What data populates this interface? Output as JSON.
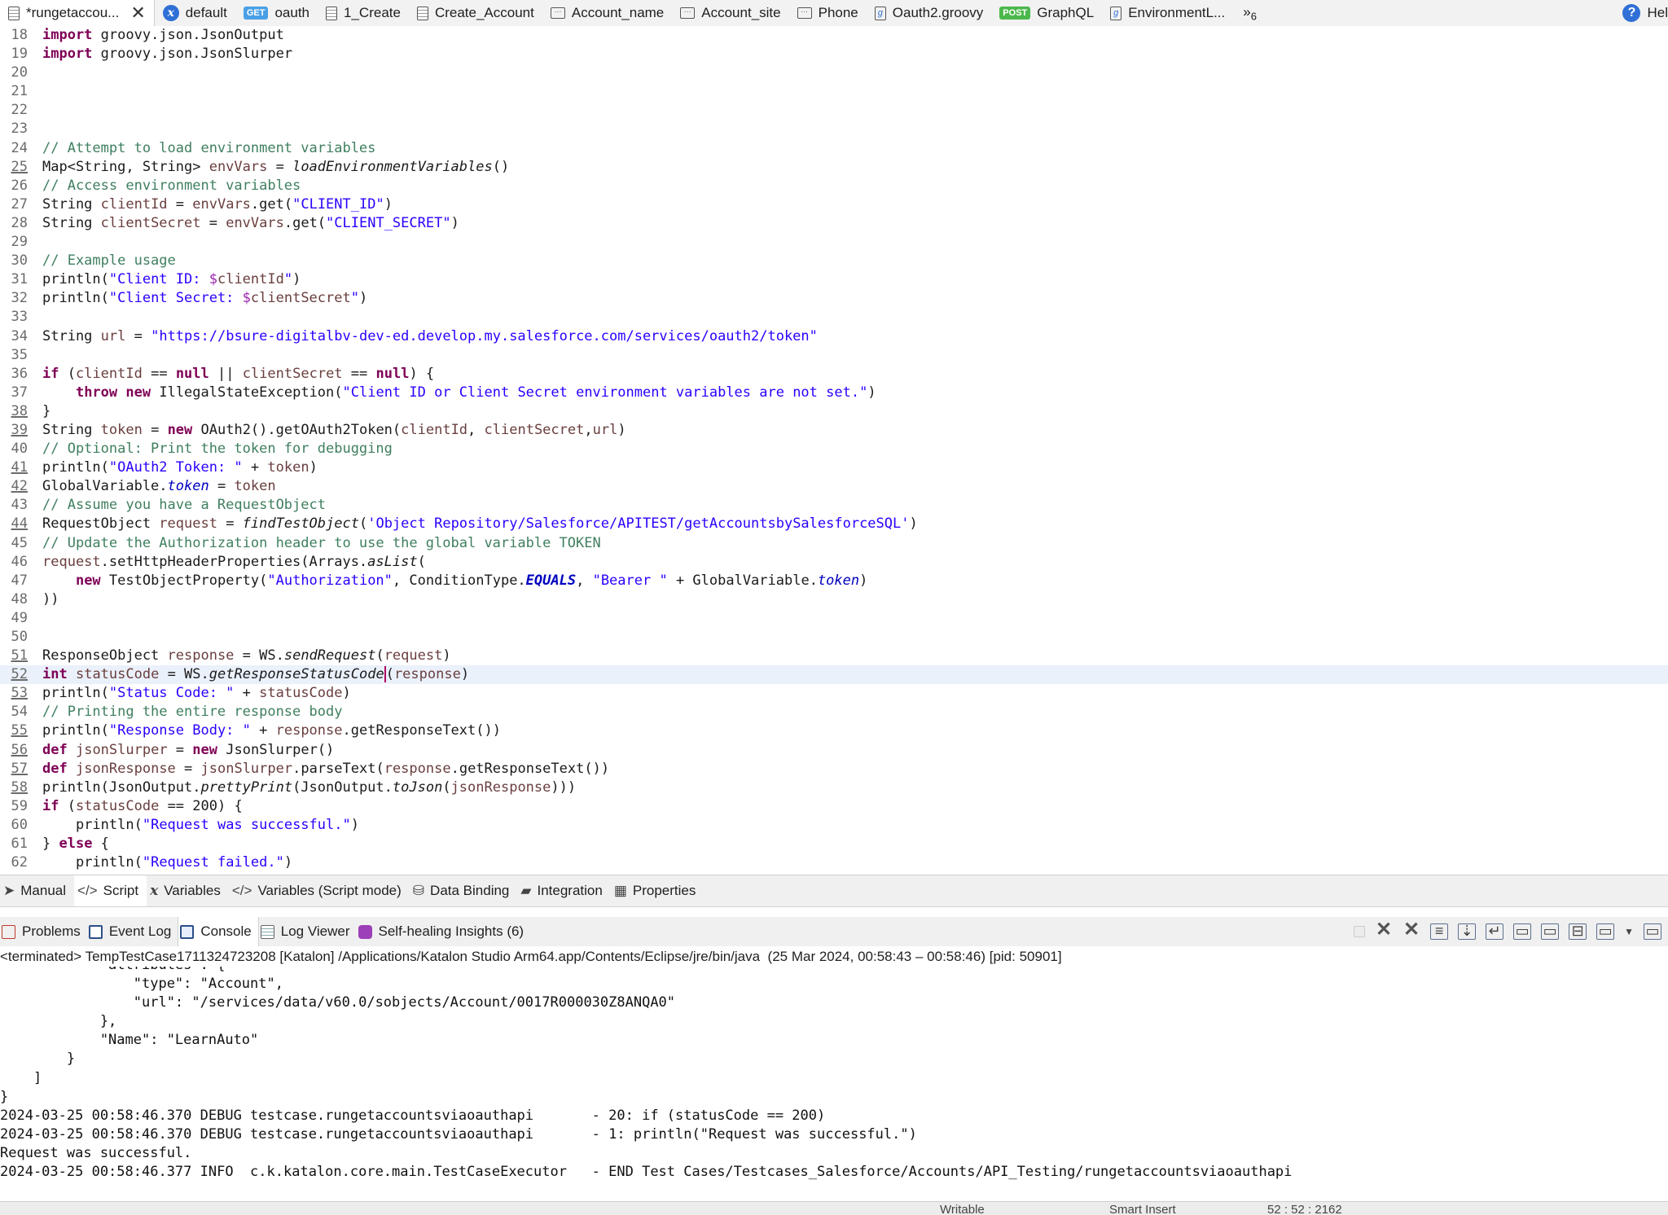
{
  "editor_tabs": [
    {
      "label": "*rungetaccou...",
      "icon": "document-icon",
      "active": true
    },
    {
      "label": "default",
      "icon": "variables-icon"
    },
    {
      "label": "oauth",
      "badge": "GET"
    },
    {
      "label": "1_Create",
      "icon": "document-icon"
    },
    {
      "label": "Create_Account",
      "icon": "document-icon"
    },
    {
      "label": "Account_name",
      "icon": "test-object-icon"
    },
    {
      "label": "Account_site",
      "icon": "test-object-icon"
    },
    {
      "label": "Phone",
      "icon": "test-object-icon"
    },
    {
      "label": "Oauth2.groovy",
      "icon": "groovy-file-icon"
    },
    {
      "label": "GraphQL",
      "badge": "POST"
    },
    {
      "label": "EnvironmentL...",
      "icon": "groovy-file-icon"
    }
  ],
  "tab_overflow": {
    "symbol": "»",
    "count": "6"
  },
  "help_label": "Hel",
  "line_numbers": [
    "18",
    "19",
    "20",
    "21",
    "22",
    "23",
    "24",
    "25",
    "26",
    "27",
    "28",
    "29",
    "30",
    "31",
    "32",
    "33",
    "34",
    "35",
    "36",
    "37",
    "38",
    "39",
    "40",
    "41",
    "42",
    "43",
    "44",
    "45",
    "46",
    "47",
    "48",
    "49",
    "50",
    "51",
    "52",
    "53",
    "54",
    "55",
    "56",
    "57",
    "58",
    "59",
    "60",
    "61",
    "62"
  ],
  "code": {
    "import_1": "import",
    "import_1_path": " groovy.json.JsonOutput",
    "import_2": "import",
    "import_2_path": " groovy.json.JsonSlurper",
    "c24": "// Attempt to load environment variables",
    "l25_a": "Map<String, String> ",
    "l25_var": "envVars",
    "l25_b": " = ",
    "l25_fn": "loadEnvironmentVariables",
    "l25_c": "()",
    "c26": "// Access environment variables",
    "l27_a": "String ",
    "l27_var": "clientId",
    "l27_b": " = ",
    "l27_v2": "envVars",
    "l27_c": ".get(",
    "l27_str": "\"CLIENT_ID\"",
    "l27_d": ")",
    "l28_a": "String ",
    "l28_var": "clientSecret",
    "l28_b": " = ",
    "l28_v2": "envVars",
    "l28_c": ".get(",
    "l28_str": "\"CLIENT_SECRET\"",
    "l28_d": ")",
    "c30": "// Example usage",
    "l31_a": "println(",
    "l31_str": "\"Client ID: ",
    "l31_dollar": "$",
    "l31_var": "clientId",
    "l31_q": "\"",
    "l31_b": ")",
    "l32_a": "println(",
    "l32_str": "\"Client Secret: ",
    "l32_dollar": "$",
    "l32_var": "clientSecret",
    "l32_q": "\"",
    "l32_b": ")",
    "l34_a": "String ",
    "l34_var": "url",
    "l34_b": " = ",
    "l34_str": "\"https://bsure-digitalbv-dev-ed.develop.my.salesforce.com/services/oauth2/token\"",
    "l36_kw": "if",
    "l36_a": " (",
    "l36_var": "clientId",
    "l36_b": " == ",
    "l36_null": "null",
    "l36_c": " || ",
    "l36_var2": "clientSecret",
    "l36_d": " == ",
    "l36_null2": "null",
    "l36_e": ") {",
    "l37_indent": "    ",
    "l37_kw": "throw",
    "l37_sp": " ",
    "l37_kw2": "new",
    "l37_a": " IllegalStateException(",
    "l37_str": "\"Client ID or Client Secret environment variables are not set.\"",
    "l37_b": ")",
    "l38": "}",
    "l39_a": "String ",
    "l39_var": "token",
    "l39_b": " = ",
    "l39_kw": "new",
    "l39_c": " OAuth2().getOAuth2Token(",
    "l39_v1": "clientId",
    "l39_d": ", ",
    "l39_v2": "clientSecret",
    "l39_e": ",",
    "l39_v3": "url",
    "l39_f": ")",
    "c40": "// Optional: Print the token for debugging",
    "l41_a": "println(",
    "l41_str": "\"OAuth2 Token: \"",
    "l41_b": " + ",
    "l41_var": "token",
    "l41_c": ")",
    "l42_a": "GlobalVariable.",
    "l42_prop": "token",
    "l42_b": " = ",
    "l42_var": "token",
    "c43": "// Assume you have a RequestObject",
    "l44_a": "RequestObject ",
    "l44_var": "request",
    "l44_b": " = ",
    "l44_fn": "findTestObject",
    "l44_c": "(",
    "l44_str": "'Object Repository/Salesforce/APITEST/getAccountsbySalesforceSQL'",
    "l44_d": ")",
    "c45": "// Update the Authorization header to use the global variable TOKEN",
    "l46_var": "request",
    "l46_a": ".setHttpHeaderProperties(Arrays.",
    "l46_fn": "asList",
    "l46_b": "(",
    "l47_indent": "    ",
    "l47_kw": "new",
    "l47_a": " TestObjectProperty(",
    "l47_str": "\"Authorization\"",
    "l47_b": ", ConditionType.",
    "l47_const": "EQUALS",
    "l47_c": ", ",
    "l47_str2": "\"Bearer \"",
    "l47_d": " + GlobalVariable.",
    "l47_prop": "token",
    "l47_e": ")",
    "l48": "))",
    "l51_a": "ResponseObject ",
    "l51_var": "response",
    "l51_b": " = WS.",
    "l51_fn": "sendRequest",
    "l51_c": "(",
    "l51_v2": "request",
    "l51_d": ")",
    "l52_kw": "int",
    "l52_sp": " ",
    "l52_var": "statusCode",
    "l52_b": " = WS.",
    "l52_fn": "getResponseStatusCode",
    "l52_c": "(",
    "l52_v2": "response",
    "l52_d": ")",
    "l53_a": "println(",
    "l53_str": "\"Status Code: \"",
    "l53_b": " + ",
    "l53_var": "statusCode",
    "l53_c": ")",
    "c54": "// Printing the entire response body",
    "l55_a": "println(",
    "l55_str": "\"Response Body: \"",
    "l55_b": " + ",
    "l55_var": "response",
    "l55_c": ".getResponseText())",
    "l56_kw": "def",
    "l56_sp": " ",
    "l56_var": "jsonSlurper",
    "l56_b": " = ",
    "l56_kw2": "new",
    "l56_c": " JsonSlurper()",
    "l57_kw": "def",
    "l57_sp": " ",
    "l57_var": "jsonResponse",
    "l57_b": " = ",
    "l57_v2": "jsonSlurper",
    "l57_c": ".parseText(",
    "l57_v3": "response",
    "l57_d": ".getResponseText())",
    "l58_a": "println(JsonOutput.",
    "l58_fn": "prettyPrint",
    "l58_b": "(JsonOutput.",
    "l58_fn2": "toJson",
    "l58_c": "(",
    "l58_var": "jsonResponse",
    "l58_d": ")))",
    "l59_kw": "if",
    "l59_a": " (",
    "l59_var": "statusCode",
    "l59_b": " == 200) {",
    "l60_indent": "    ",
    "l60_a": "println(",
    "l60_str": "\"Request was successful.\"",
    "l60_b": ")",
    "l61_a": "} ",
    "l61_kw": "else",
    "l61_b": " {",
    "l62_indent": "    ",
    "l62_a": "println(",
    "l62_str": "\"Request failed.\"",
    "l62_b": ")"
  },
  "mode_tabs": [
    {
      "label": "Manual",
      "icon": "cursor-icon"
    },
    {
      "label": "Script",
      "icon": "code-icon",
      "active": true
    },
    {
      "label": "Variables",
      "icon": "variable-icon"
    },
    {
      "label": "Variables (Script mode)",
      "icon": "code-icon"
    },
    {
      "label": "Data Binding",
      "icon": "database-icon"
    },
    {
      "label": "Integration",
      "icon": "integration-icon"
    },
    {
      "label": "Properties",
      "icon": "table-icon"
    }
  ],
  "panel_tabs": [
    {
      "label": "Problems",
      "icon": "problems-icon"
    },
    {
      "label": "Event Log",
      "icon": "event-log-icon"
    },
    {
      "label": "Console",
      "icon": "console-icon",
      "active": true
    },
    {
      "label": "Log Viewer",
      "icon": "log-viewer-icon"
    },
    {
      "label": "Self-healing Insights (6)",
      "icon": "self-healing-icon"
    }
  ],
  "console_status": "<terminated> TempTestCase1711324723208 [Katalon] /Applications/Katalon Studio Arm64.app/Contents/Eclipse/jre/bin/java  (25 Mar 2024, 00:58:43 – 00:58:46) [pid: 50901]",
  "console_lines": [
    "            \"attributes\": {",
    "                \"type\": \"Account\",",
    "                \"url\": \"/services/data/v60.0/sobjects/Account/0017R000030Z8ANQA0\"",
    "            },",
    "            \"Name\": \"LearnAuto\"",
    "        }",
    "    ]",
    "}",
    "2024-03-25 00:58:46.370 DEBUG testcase.rungetaccountsviaoauthapi       - 20: if (statusCode == 200)",
    "2024-03-25 00:58:46.370 DEBUG testcase.rungetaccountsviaoauthapi       - 1: println(\"Request was successful.\")",
    "Request was successful.",
    "2024-03-25 00:58:46.377 INFO  c.k.katalon.core.main.TestCaseExecutor   - END Test Cases/Testcases_Salesforce/Accounts/API_Testing/rungetaccountsviaoauthapi"
  ],
  "status_bar": {
    "writable": "Writable",
    "insert_mode": "Smart Insert",
    "position": "52 : 52 : 2162"
  },
  "colors": {
    "keyword": "#7f0055",
    "string": "#2a00ff",
    "comment": "#3f7f5f",
    "variable": "#6a3e3e",
    "current_line": "#eaf1fb"
  }
}
